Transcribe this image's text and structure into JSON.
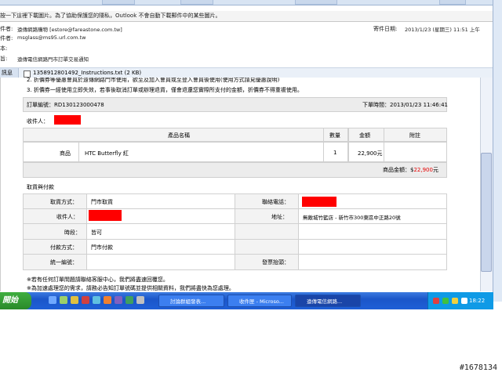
{
  "infobar": {
    "text": "按一下這裡下載圖片。為了協助保護您的隱私，Outlook 不會自動下載郵件中的某些圖片。"
  },
  "header": {
    "from_label": "件者:",
    "from_value": "遠傳網路購物 [estore@fareastone.com.tw]",
    "to_label": "件者:",
    "to_value": "msglass@ms95.url.com.tw",
    "cc_label": "本:",
    "subject_label": "旨:",
    "subject_value": "遠傳電信網路門市訂單交易通知",
    "sent_label": "寄件日期:",
    "sent_value": "2013/1/23 (星期三) 11:51 上午"
  },
  "attachment": {
    "tab_label": "訊息",
    "file": "1358912801492_Instructions.txt (2 KB)"
  },
  "notice_top": "2. 折價券等優惠會員於遠傳網路門市使用，欲至及加入會員或至登入會員後使用(使用方式請見優惠說明)",
  "notice_3": "3. 折價券一經使用立即失效，若事後取消訂單或辦理退貨，僅會退還您實際所支付的金額，折價券不得重複使用。",
  "order": {
    "number_label": "訂單編號：RD130123000478",
    "time_label": "下單時間：2013/01/23 11:46:41",
    "recipient_label": "收件人："
  },
  "items_table": {
    "headers": [
      "產品名稱",
      "數量",
      "金額",
      "附註"
    ],
    "row": {
      "type": "商品",
      "name": "HTC Butterfly 紅",
      "qty": "1",
      "amount": "22,900元",
      "note": ""
    }
  },
  "total": {
    "label": "商品金額：$",
    "value": "22,900",
    "unit": "元"
  },
  "pickup": {
    "section_title": "取貨與付款",
    "method_label": "取貨方式：",
    "method_value": "門市取貨",
    "phone_label": "聯絡電話：",
    "recipient_label": "收件人：",
    "address_label": "地址：",
    "address_value": "無敵城竹籃店 - 新竹市300東區中正路20號",
    "period_label": "時段：",
    "period_value": "皆可",
    "payment_label": "付款方式：",
    "payment_value": "門市付款",
    "taxid_label": "統一編號：",
    "invoice_label": "發票抬頭："
  },
  "footer_note": "※若有任何訂單問題請聯絡客服中心，我們將盡速回覆您。",
  "footer_note2": "※為加速處理您的需求，請務必告知訂單號碼並提供相關資料，我們將盡快為您處理。",
  "taskbar": {
    "start_label": "開始",
    "buttons": [
      "討論群組發表...",
      "收件匣 - Microso...",
      "遠傳電信網路..."
    ],
    "clock": "18:22"
  },
  "watermark": "#1678134",
  "colors": {
    "redact": "#ff0000",
    "taskbar": "#1f5fd6",
    "price_red": "#e60000"
  }
}
